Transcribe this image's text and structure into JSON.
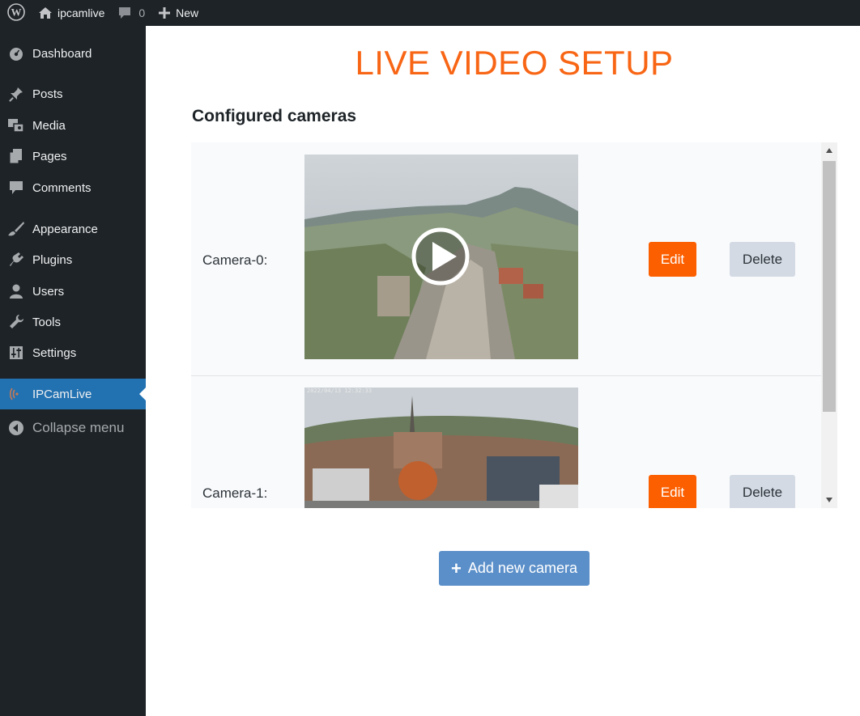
{
  "adminbar": {
    "site_name": "ipcamlive",
    "comments_count": "0",
    "new_label": "New"
  },
  "sidebar": {
    "items": [
      {
        "label": "Dashboard",
        "icon": "dashboard-icon"
      },
      {
        "label": "Posts",
        "icon": "pin-icon"
      },
      {
        "label": "Media",
        "icon": "media-icon"
      },
      {
        "label": "Pages",
        "icon": "pages-icon"
      },
      {
        "label": "Comments",
        "icon": "comment-icon"
      },
      {
        "label": "Appearance",
        "icon": "brush-icon"
      },
      {
        "label": "Plugins",
        "icon": "plugin-icon"
      },
      {
        "label": "Users",
        "icon": "user-icon"
      },
      {
        "label": "Tools",
        "icon": "wrench-icon"
      },
      {
        "label": "Settings",
        "icon": "settings-icon"
      },
      {
        "label": "IPCamLive",
        "icon": "broadcast-icon",
        "active": true
      },
      {
        "label": "Collapse menu",
        "icon": "collapse-icon"
      }
    ]
  },
  "main": {
    "title": "LIVE VIDEO SETUP",
    "section_title": "Configured cameras",
    "cameras": [
      {
        "label": "Camera-0:",
        "edit_label": "Edit",
        "delete_label": "Delete"
      },
      {
        "label": "Camera-1:",
        "edit_label": "Edit",
        "delete_label": "Delete",
        "timestamp": "2022/04/13 12:32:33"
      }
    ],
    "add_button_label": "Add new camera"
  },
  "colors": {
    "accent": "#f86615",
    "edit_button": "#fc5f00",
    "delete_button": "#d3dae4",
    "add_button": "#5b8fc9",
    "sidebar_bg": "#1d2327",
    "active_menu": "#2271b1"
  }
}
